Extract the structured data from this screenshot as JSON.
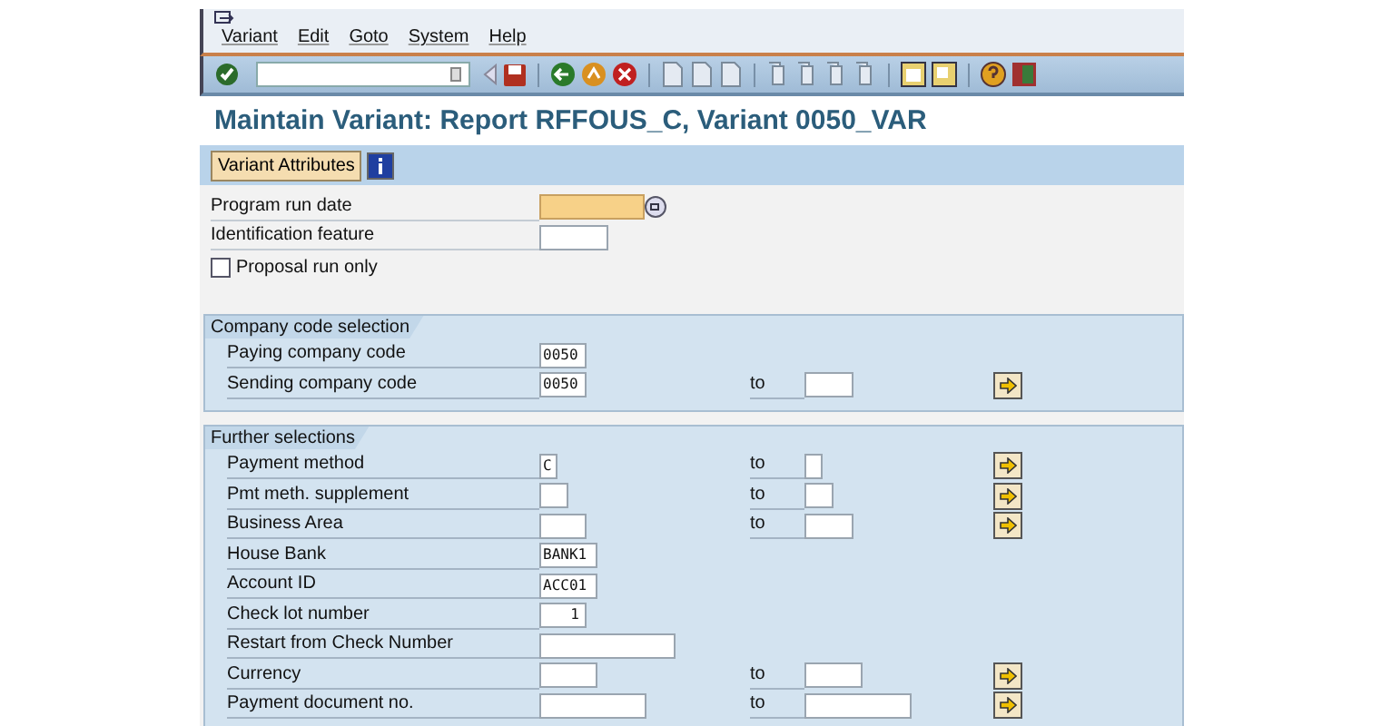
{
  "menu": [
    "Variant",
    "Edit",
    "Goto",
    "System",
    "Help"
  ],
  "title": "Maintain Variant: Report RFFOUS_C, Variant 0050_VAR",
  "app_toolbar": {
    "button": "Variant Attributes"
  },
  "params": [
    {
      "kind": "field",
      "label": "Program run date",
      "focused": true
    },
    {
      "kind": "field",
      "label": "Identification feature",
      "focused": false
    },
    {
      "kind": "checkbox",
      "label": "Proposal run only",
      "checked": false
    }
  ],
  "sections": [
    {
      "title": "Company code selection",
      "rows": [
        {
          "label": "Paying company code",
          "value": "0050"
        },
        {
          "label": "Sending company code",
          "value": "0050",
          "range": {
            "label": "to"
          }
        }
      ]
    },
    {
      "title": "Further selections",
      "rows": [
        {
          "label": "Payment method",
          "value": "C",
          "range": {
            "label": "to"
          }
        },
        {
          "label": "Pmt meth. supplement",
          "range": {
            "label": "to"
          }
        },
        {
          "label": "Business Area",
          "range": {
            "label": "to"
          }
        },
        {
          "label": "House Bank",
          "value": "BANK1"
        },
        {
          "label": "Account ID",
          "value": "ACC01"
        },
        {
          "label": "Check lot number",
          "value": "1",
          "right_aligned": true
        },
        {
          "label": "Restart from Check Number"
        },
        {
          "label": "Currency",
          "range": {
            "label": "to"
          }
        },
        {
          "label": "Payment document no.",
          "range": {
            "label": "to"
          }
        }
      ]
    }
  ]
}
